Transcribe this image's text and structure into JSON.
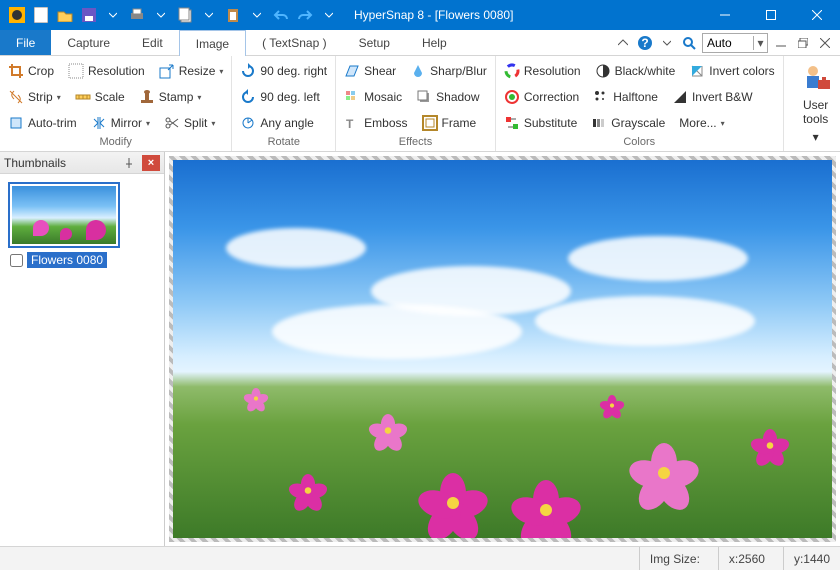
{
  "title": "HyperSnap 8 - [Flowers 0080]",
  "menu": {
    "items": [
      "File",
      "Capture",
      "Edit",
      "Image",
      "( TextSnap )",
      "Setup",
      "Help"
    ],
    "active_index": 0,
    "selected_index": 3
  },
  "zoom": {
    "value": "Auto"
  },
  "ribbon": {
    "modify": {
      "label": "Modify",
      "crop": "Crop",
      "resolution": "Resolution",
      "resize": "Resize",
      "strip": "Strip",
      "scale": "Scale",
      "stamp": "Stamp",
      "autotrim": "Auto-trim",
      "mirror": "Mirror",
      "split": "Split"
    },
    "rotate": {
      "label": "Rotate",
      "r90r": "90 deg. right",
      "r90l": "90 deg. left",
      "anyangle": "Any angle"
    },
    "effects": {
      "label": "Effects",
      "shear": "Shear",
      "sharpblur": "Sharp/Blur",
      "mosaic": "Mosaic",
      "shadow": "Shadow",
      "emboss": "Emboss",
      "frame": "Frame"
    },
    "colors": {
      "label": "Colors",
      "resolution": "Resolution",
      "blackwhite": "Black/white",
      "invertcolors": "Invert colors",
      "correction": "Correction",
      "halftone": "Halftone",
      "invertbw": "Invert B&W",
      "substitute": "Substitute",
      "grayscale": "Grayscale",
      "more": "More..."
    },
    "usertools": {
      "label": "User\ntools"
    }
  },
  "thumbnails": {
    "title": "Thumbnails",
    "items": [
      {
        "label": "Flowers 0080",
        "checked": false
      }
    ]
  },
  "status": {
    "imgsize_label": "Img Size:",
    "x_label": "x:",
    "x_value": "2560",
    "y_label": "y:",
    "y_value": "1440"
  }
}
